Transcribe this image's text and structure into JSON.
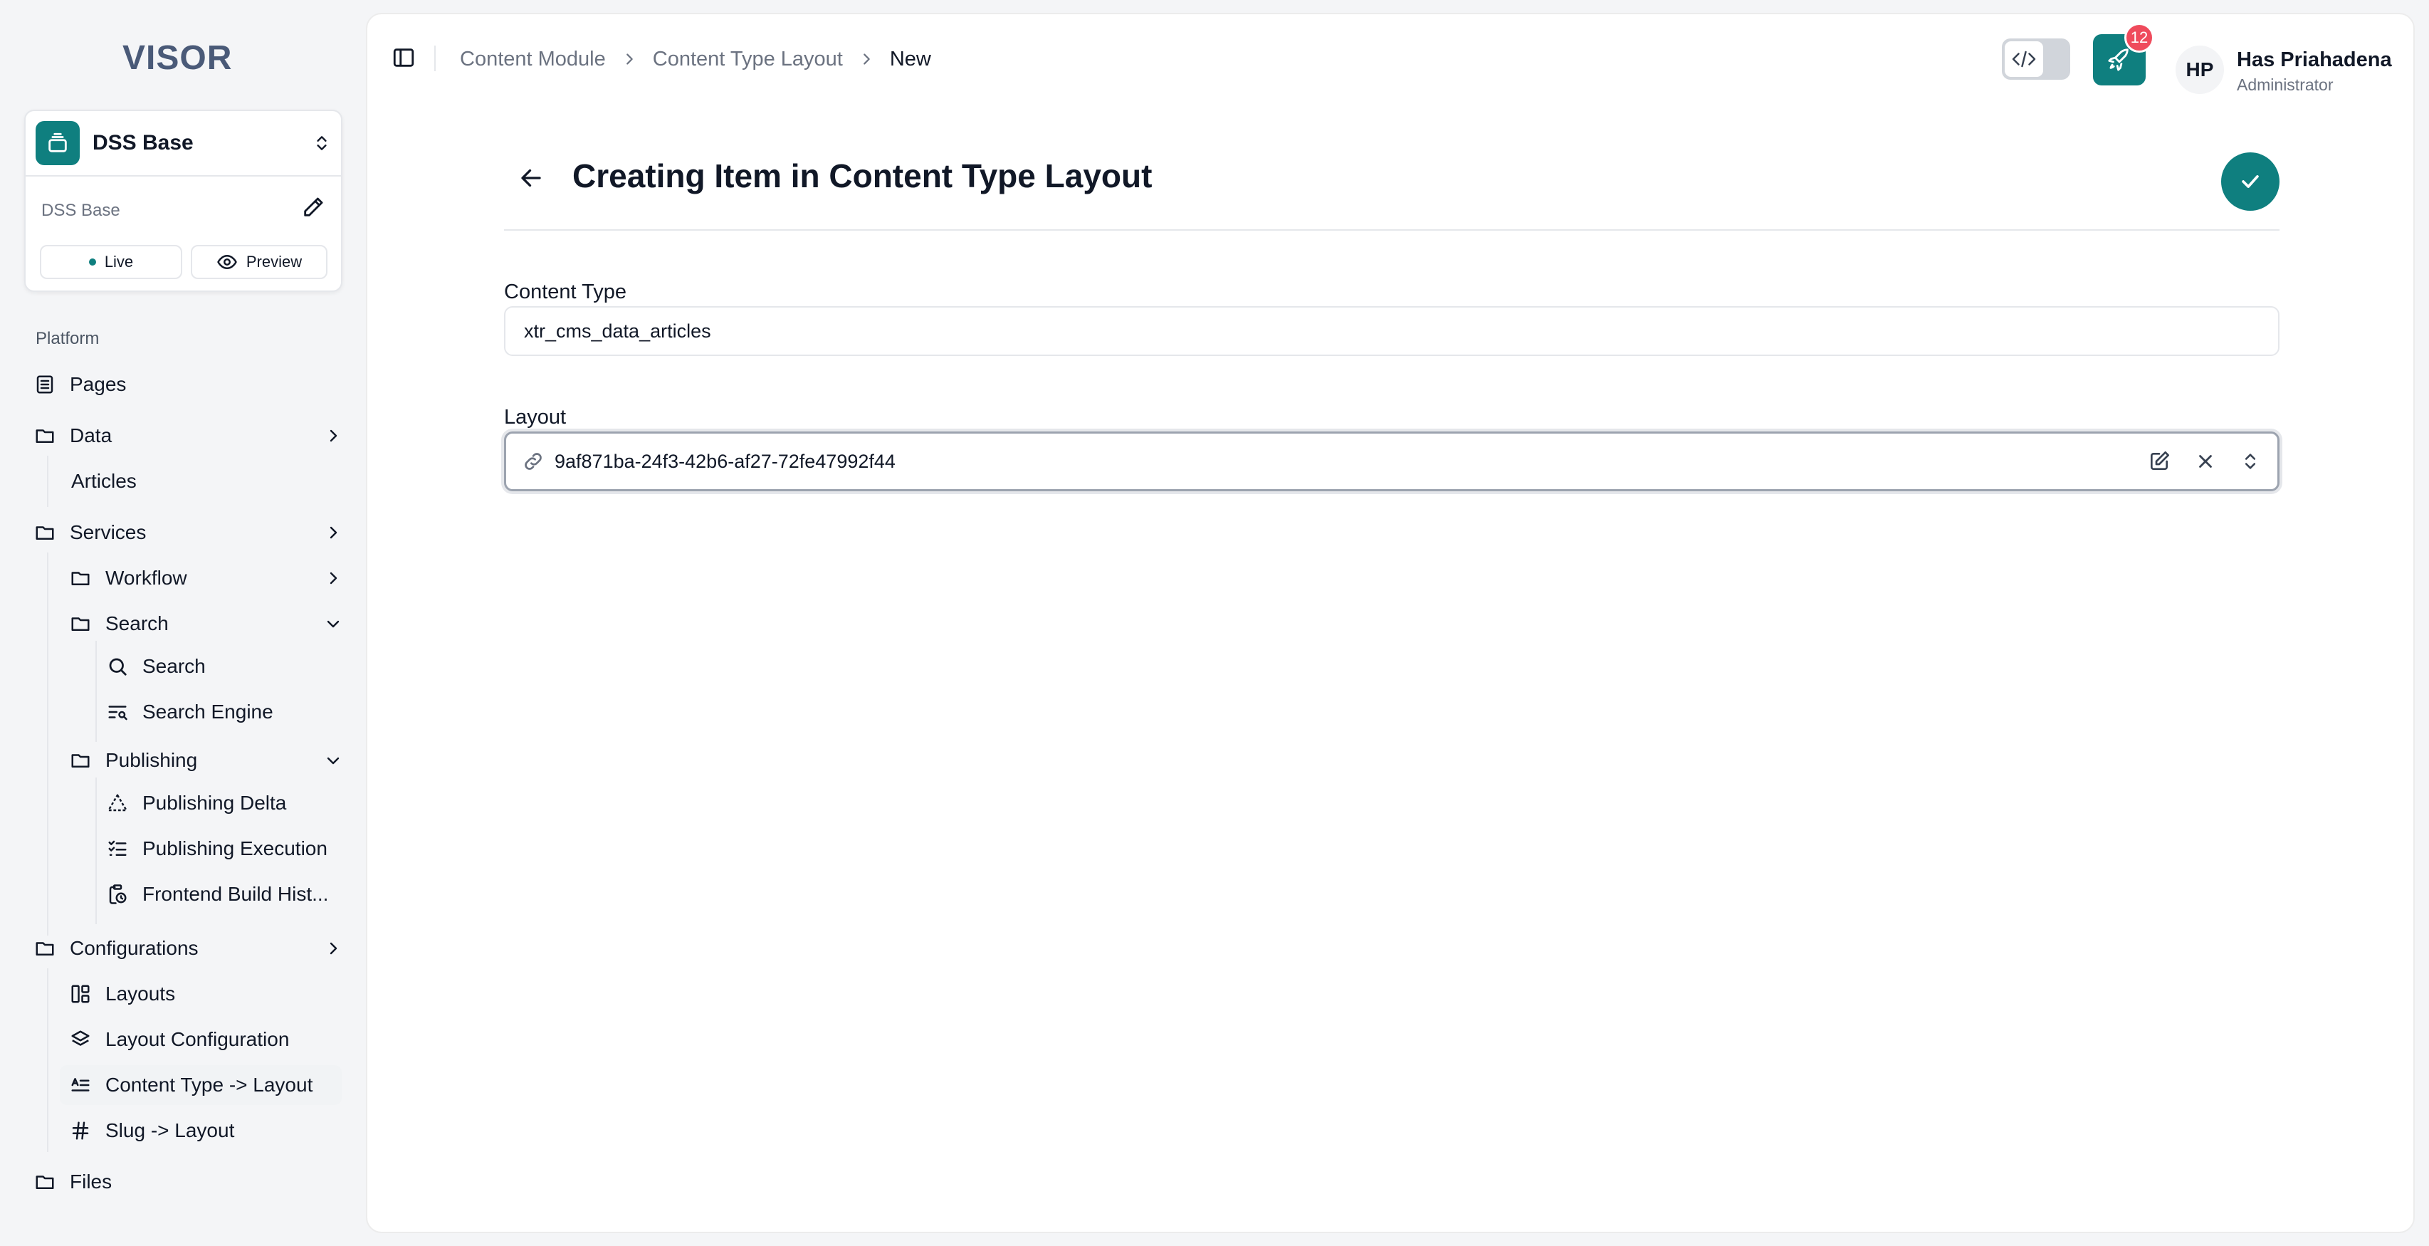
{
  "app": {
    "logo_text": "VISOR"
  },
  "workspace": {
    "name": "DSS Base",
    "sub_label": "DSS Base",
    "live_label": "Live",
    "preview_label": "Preview"
  },
  "sidebar": {
    "section_label": "Platform",
    "items": {
      "pages": "Pages",
      "data": "Data",
      "articles": "Articles",
      "services": "Services",
      "workflow": "Workflow",
      "search_folder": "Search",
      "search": "Search",
      "search_engine": "Search Engine",
      "publishing": "Publishing",
      "publishing_delta": "Publishing Delta",
      "publishing_execution": "Publishing Execution",
      "frontend_build": "Frontend Build Hist...",
      "configurations": "Configurations",
      "layouts": "Layouts",
      "layout_configuration": "Layout Configuration",
      "content_type_layout": "Content Type -> Layout",
      "slug_layout": "Slug -> Layout",
      "files": "Files"
    }
  },
  "header": {
    "breadcrumb": [
      "Content Module",
      "Content Type Layout",
      "New"
    ],
    "notification_count": "12",
    "user": {
      "initials": "HP",
      "name": "Has Priahadena",
      "role": "Administrator"
    }
  },
  "form": {
    "title": "Creating Item in Content Type Layout",
    "content_type_label": "Content Type",
    "content_type_value": "xtr_cms_data_articles",
    "layout_label": "Layout",
    "layout_value": "9af871ba-24f3-42b6-af27-72fe47992f44"
  },
  "colors": {
    "accent": "#0f7f7f",
    "badge": "#ef4b5c"
  }
}
